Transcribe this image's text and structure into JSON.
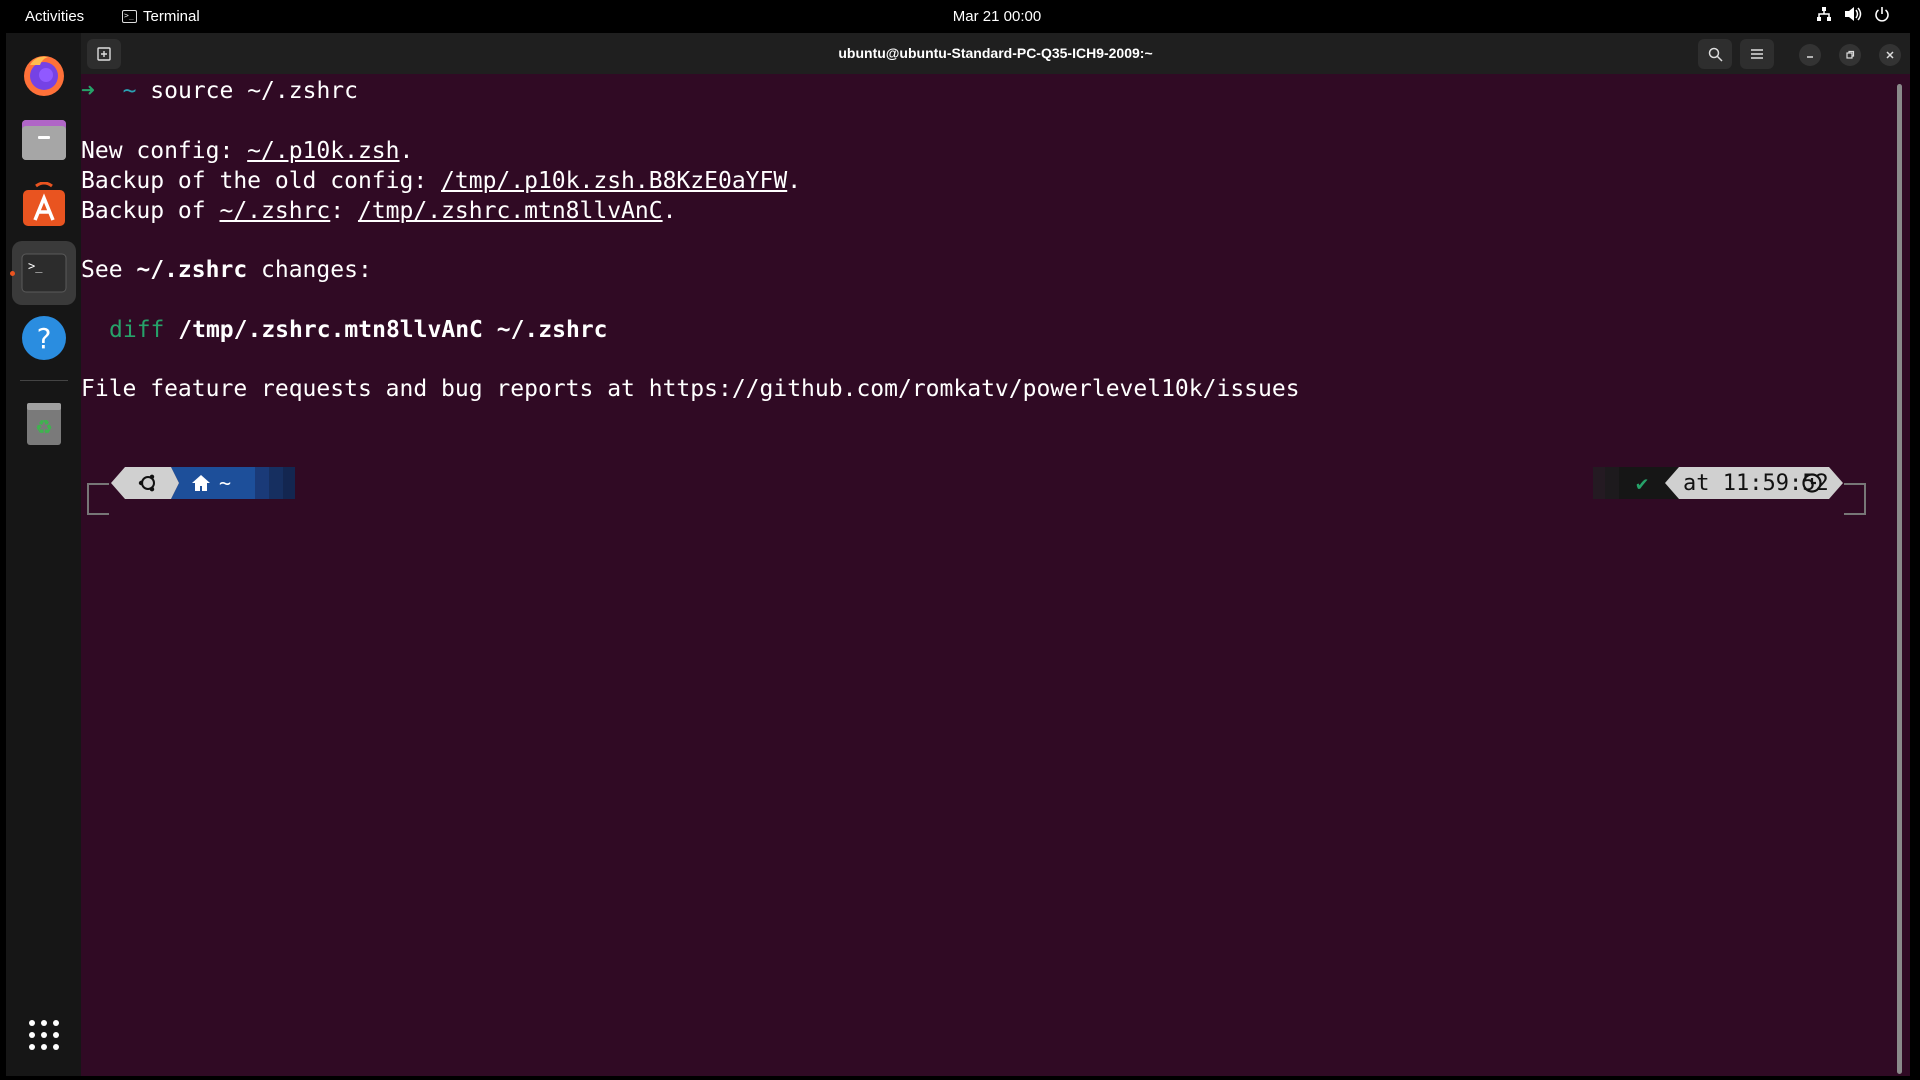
{
  "topbar": {
    "activities": "Activities",
    "app_name": "Terminal",
    "clock": "Mar 21  00:00"
  },
  "dock": {
    "items": [
      {
        "name": "Firefox"
      },
      {
        "name": "Files"
      },
      {
        "name": "Ubuntu Software"
      },
      {
        "name": "Terminal"
      },
      {
        "name": "Help"
      },
      {
        "name": "Trash"
      },
      {
        "name": "Show Applications"
      }
    ]
  },
  "window": {
    "title": "ubuntu@ubuntu-Standard-PC-Q35-ICH9-2009:~"
  },
  "terminal": {
    "prompt_arrow": "➜",
    "prompt_dir": "~",
    "command": "source ~/.zshrc",
    "new_config_label": "New config: ",
    "new_config_path": "~/.p10k.zsh",
    "backup_old_label": "Backup of the old config: ",
    "backup_old_path": "/tmp/.p10k.zsh.B8KzE0aYFW",
    "backup_of_label": "Backup of ",
    "backup_of_src": "~/.zshrc",
    "backup_of_dst": "/tmp/.zshrc.mtn8llvAnC",
    "period": ".",
    "colon": ": ",
    "see_label": "See ",
    "see_file": "~/.zshrc",
    "see_suffix": " changes:",
    "diff_cmd": "diff",
    "diff_args": "/tmp/.zshrc.mtn8llvAnC ~/.zshrc",
    "feature_text": "File feature requests and bug reports at https://github.com/romkatv/powerlevel10k/issues",
    "p10k_home_dir": "~",
    "p10k_status": "✔",
    "p10k_time": "at 11:59:52"
  },
  "colors": {
    "terminal_bg": "#300a24",
    "accent": "#e95420",
    "prompt_green": "#26a269",
    "prompt_cyan": "#2aa1b3"
  }
}
